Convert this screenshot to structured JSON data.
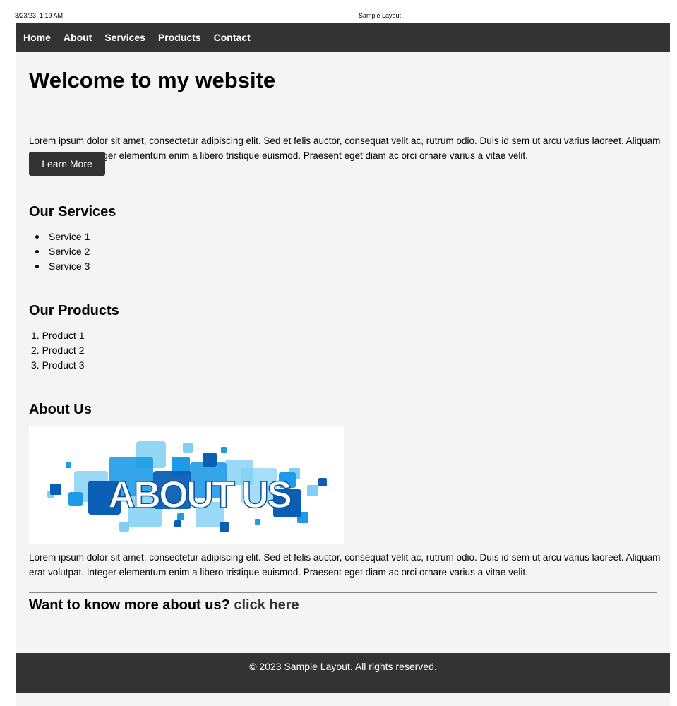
{
  "print_header": {
    "date": "3/23/23, 1:19 AM",
    "title": "Sample Layout"
  },
  "nav": {
    "items": [
      {
        "label": "Home"
      },
      {
        "label": "About"
      },
      {
        "label": "Services"
      },
      {
        "label": "Products"
      },
      {
        "label": "Contact"
      }
    ]
  },
  "hero": {
    "title": "Welcome to my website",
    "text": "Lorem ipsum dolor sit amet, consectetur adipiscing elit. Sed et felis auctor, consequat velit ac, rutrum odio. Duis id sem ut arcu varius laoreet. Aliquam erat volutpat. Integer elementum enim a libero tristique euismod. Praesent eget diam ac orci ornare varius a vitae velit.",
    "button_label": "Learn More"
  },
  "services": {
    "title": "Our Services",
    "items": [
      "Service 1",
      "Service 2",
      "Service 3"
    ]
  },
  "products": {
    "title": "Our Products",
    "items": [
      "1. Product 1",
      "2. Product 2",
      "3. Product 3"
    ]
  },
  "about": {
    "title": "About Us",
    "image_text": "ABOUT US",
    "text": "Lorem ipsum dolor sit amet, consectetur adipiscing elit. Sed et felis auctor, consequat velit ac, rutrum odio. Duis id sem ut arcu varius laoreet. Aliquam erat volutpat. Integer elementum enim a libero tristique euismod. Praesent eget diam ac orci ornare varius a vitae velit."
  },
  "cta": {
    "text": "Want to know more about us?",
    "link_label": "click here"
  },
  "footer": {
    "text": "© 2023 Sample Layout. All rights reserved."
  },
  "colors": {
    "nav_bg": "#333333",
    "page_bg": "#f4f4f4",
    "image_blue_dark": "#0a5fb4",
    "image_blue_mid": "#1e9be6",
    "image_blue_light": "#7fd0f5"
  }
}
